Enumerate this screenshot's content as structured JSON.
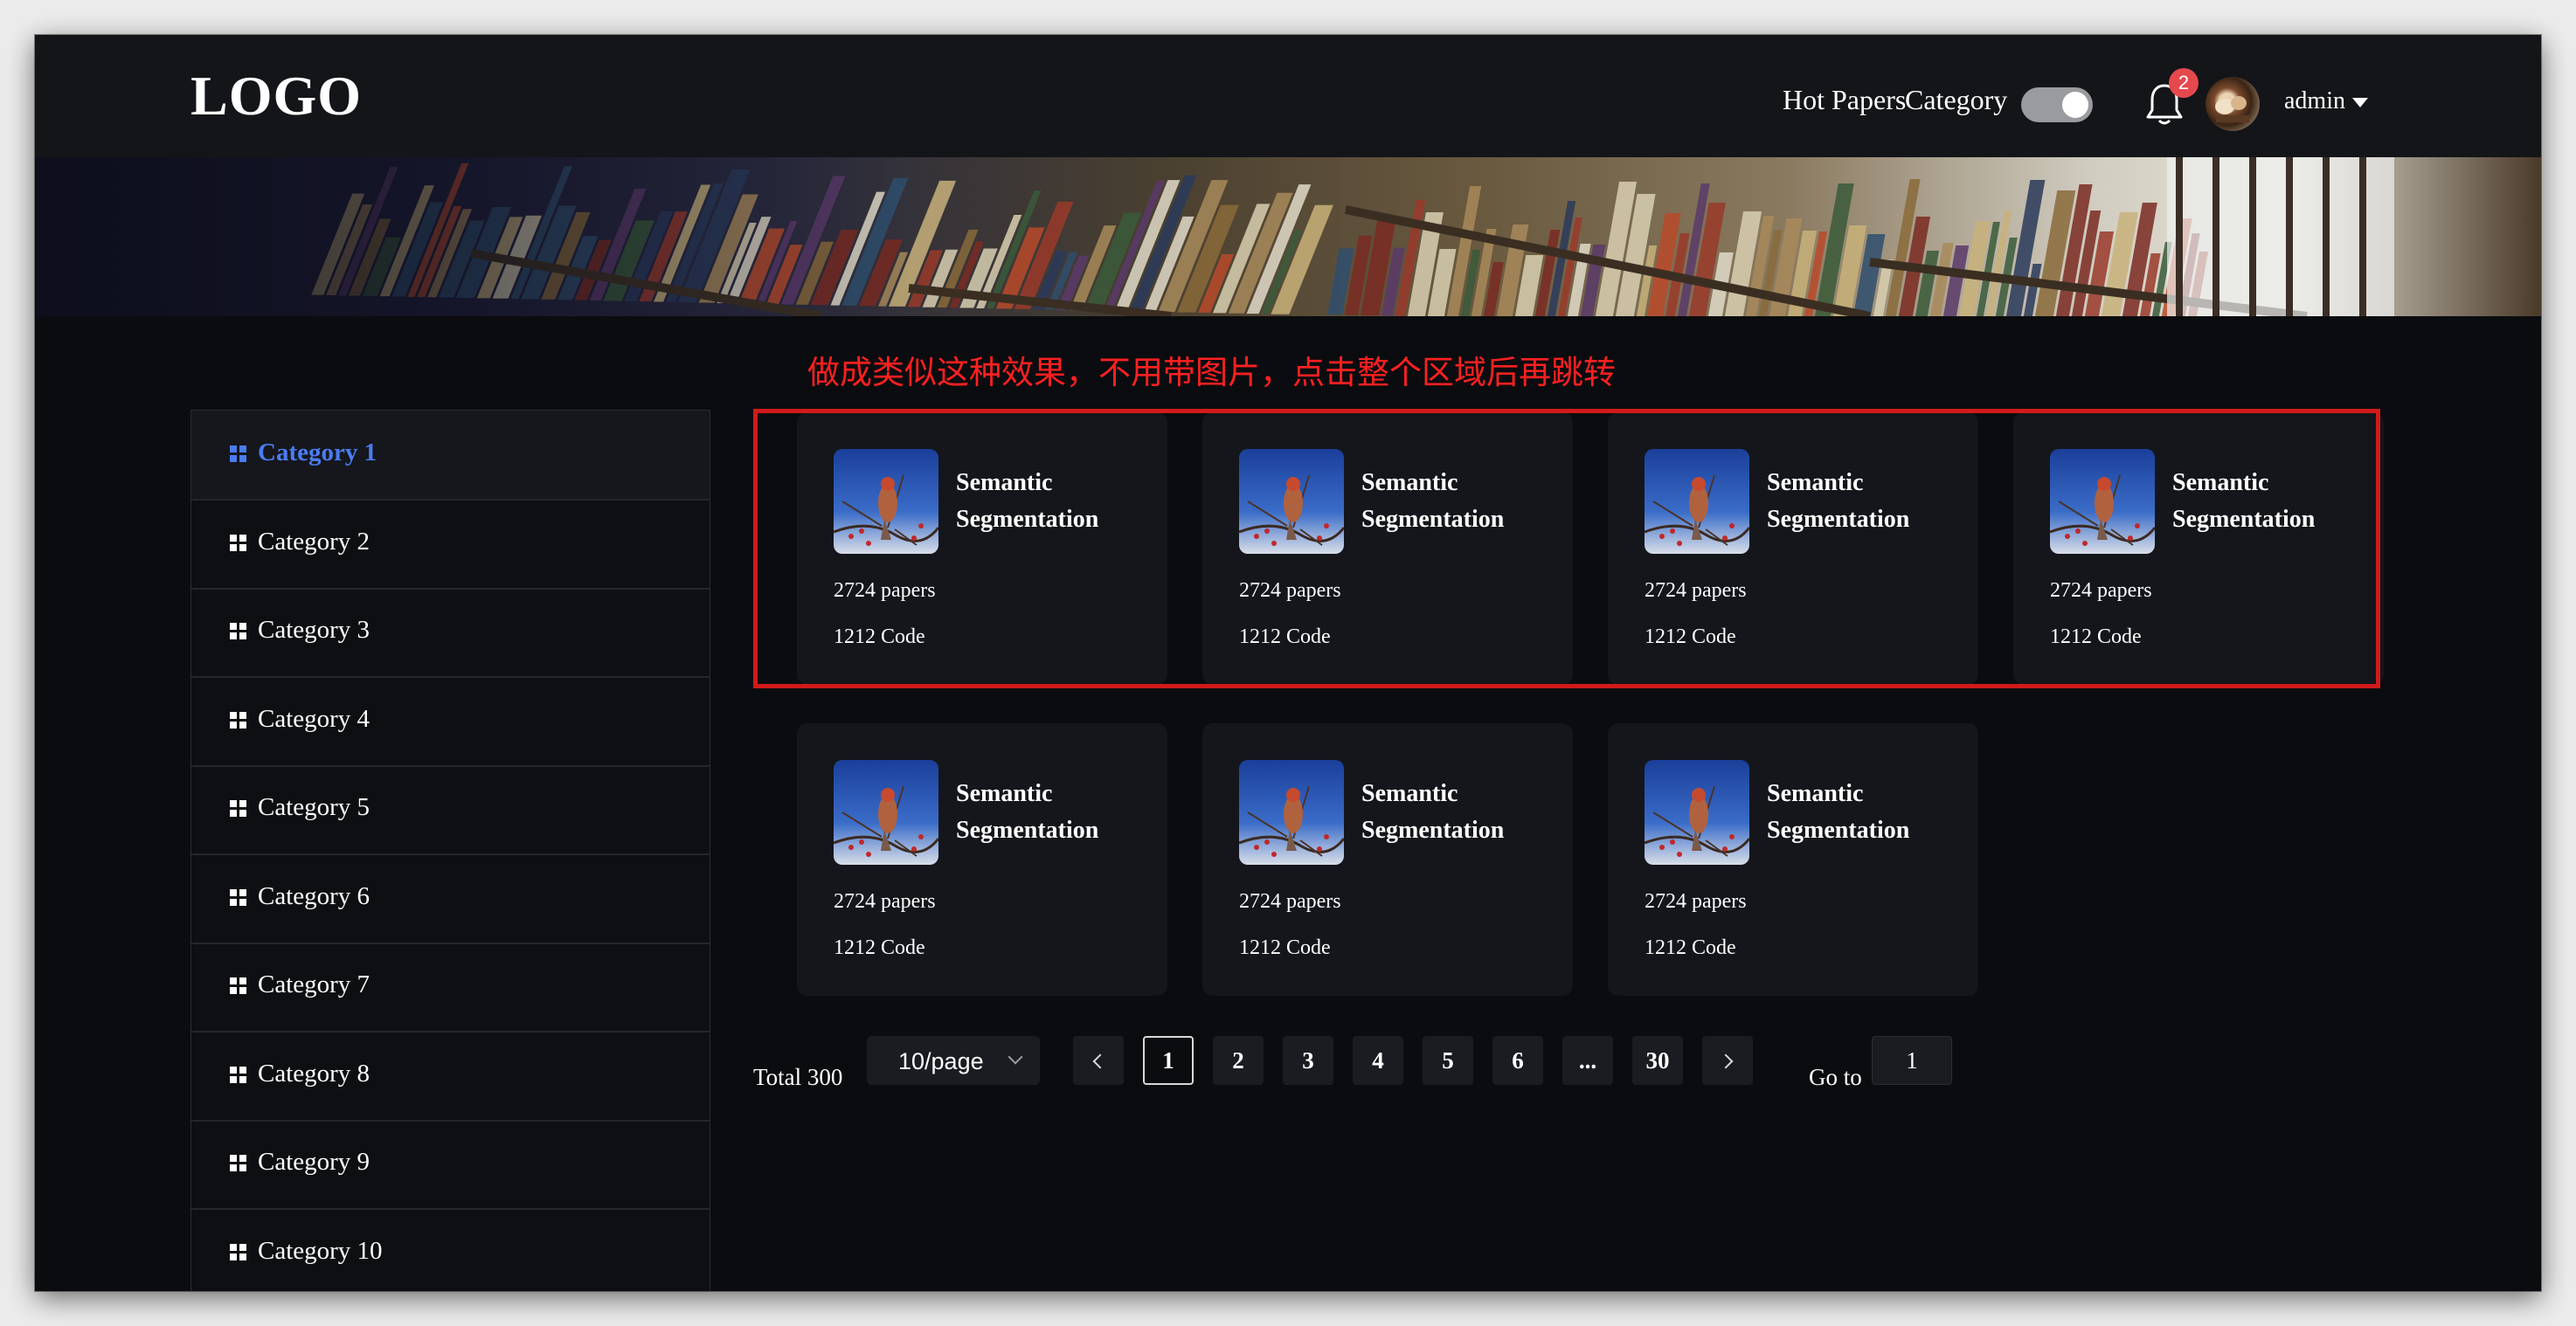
{
  "header": {
    "logo": "LOGO",
    "nav": [
      "Hot Papers",
      "Category"
    ],
    "toggle_on": true,
    "notification_count": "2",
    "user_name": "admin"
  },
  "annotation": "做成类似这种效果，不用带图片，点击整个区域后再跳转",
  "sidebar": {
    "items": [
      {
        "label": "Category 1",
        "active": true
      },
      {
        "label": "Category 2",
        "active": false
      },
      {
        "label": "Category 3",
        "active": false
      },
      {
        "label": "Category 4",
        "active": false
      },
      {
        "label": "Category 5",
        "active": false
      },
      {
        "label": "Category 6",
        "active": false
      },
      {
        "label": "Category 7",
        "active": false
      },
      {
        "label": "Category 8",
        "active": false
      },
      {
        "label": "Category 9",
        "active": false
      },
      {
        "label": "Category 10",
        "active": false
      }
    ]
  },
  "cards": [
    {
      "title": "Semantic Segmentation",
      "papers": "2724 papers",
      "code": "1212 Code"
    },
    {
      "title": "Semantic Segmentation",
      "papers": "2724 papers",
      "code": "1212 Code"
    },
    {
      "title": "Semantic Segmentation",
      "papers": "2724 papers",
      "code": "1212 Code"
    },
    {
      "title": "Semantic Segmentation",
      "papers": "2724 papers",
      "code": "1212 Code"
    },
    {
      "title": "Semantic Segmentation",
      "papers": "2724 papers",
      "code": "1212 Code"
    },
    {
      "title": "Semantic Segmentation",
      "papers": "2724 papers",
      "code": "1212 Code"
    },
    {
      "title": "Semantic Segmentation",
      "papers": "2724 papers",
      "code": "1212 Code"
    }
  ],
  "pagination": {
    "total": "Total 300",
    "page_size": "10/page",
    "pages": [
      "1",
      "2",
      "3",
      "4",
      "5",
      "6",
      "...",
      "30"
    ],
    "current_page": "1",
    "goto_label": "Go to",
    "goto_value": "1"
  },
  "colors": {
    "background": "#0b0c0f",
    "header": "#131519",
    "card": "#14161b",
    "accent": "#4a7bf0",
    "annotation": "#ff2020",
    "highlight_border": "#d11a1a",
    "badge": "#e5484d"
  },
  "icons": [
    "bell-icon",
    "grid-icon",
    "caret-down-icon",
    "chevron-left-icon",
    "chevron-right-icon",
    "chevron-down-icon"
  ]
}
